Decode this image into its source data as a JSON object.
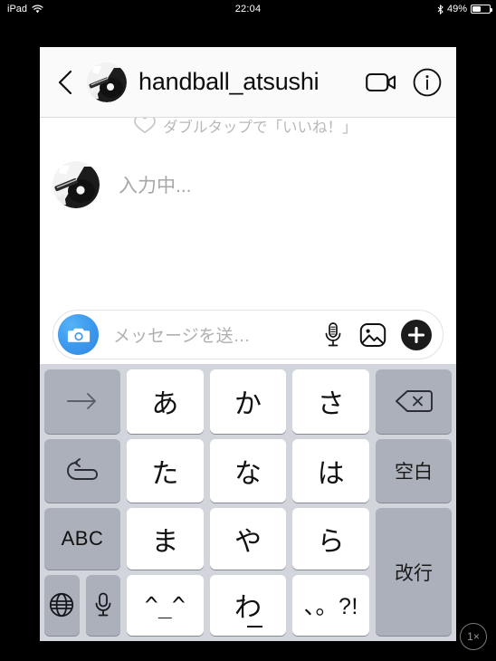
{
  "status_bar": {
    "device_label": "iPad",
    "wifi_icon": "wifi-icon",
    "time": "22:04",
    "bluetooth_icon": "bluetooth-icon",
    "battery_percent": "49%",
    "battery_level": 49
  },
  "nav": {
    "back_icon": "back-chevron-icon",
    "avatar_icon": "user-avatar-guitar-image",
    "title": "handball_atsushi",
    "video_call_icon": "video-camera-icon",
    "info_icon": "info-circle-icon"
  },
  "conversation": {
    "hint_icon": "heart-outline-icon",
    "hint_text": "ダブルタップで「いいね！」",
    "typing_avatar": "user-avatar-guitar-image",
    "typing_text": "入力中..."
  },
  "composer": {
    "camera_icon": "camera-icon",
    "placeholder": "メッセージを送…",
    "mic_icon": "microphone-icon",
    "photo_icon": "photo-gallery-icon",
    "add_icon": "plus-circle-icon"
  },
  "keyboard": {
    "rows": [
      [
        {
          "label": "→",
          "name": "key-arrow-right",
          "style": "grey",
          "kind": "side"
        },
        {
          "label": "あ",
          "name": "key-a",
          "style": "white",
          "kind": "char"
        },
        {
          "label": "か",
          "name": "key-ka",
          "style": "white",
          "kind": "char"
        },
        {
          "label": "さ",
          "name": "key-sa",
          "style": "white",
          "kind": "char"
        },
        {
          "label": "⌫",
          "name": "key-delete",
          "style": "grey",
          "kind": "side"
        }
      ],
      [
        {
          "label": "↺",
          "name": "key-undo",
          "style": "grey",
          "kind": "side"
        },
        {
          "label": "た",
          "name": "key-ta",
          "style": "white",
          "kind": "char"
        },
        {
          "label": "な",
          "name": "key-na",
          "style": "white",
          "kind": "char"
        },
        {
          "label": "は",
          "name": "key-ha",
          "style": "white",
          "kind": "char"
        },
        {
          "label": "空白",
          "name": "key-space",
          "style": "grey",
          "kind": "side"
        }
      ],
      [
        {
          "label": "ABC",
          "name": "key-abc",
          "style": "grey",
          "kind": "side"
        },
        {
          "label": "ま",
          "name": "key-ma",
          "style": "white",
          "kind": "char"
        },
        {
          "label": "や",
          "name": "key-ya",
          "style": "white",
          "kind": "char"
        },
        {
          "label": "ら",
          "name": "key-ra",
          "style": "white",
          "kind": "char"
        },
        {
          "label": "改行",
          "name": "key-return",
          "style": "grey",
          "kind": "side-tall"
        }
      ],
      [
        {
          "label": "🌐",
          "name": "key-globe",
          "style": "grey",
          "kind": "side-narrow"
        },
        {
          "label": "🎤",
          "name": "key-dictation",
          "style": "grey",
          "kind": "side-narrow"
        },
        {
          "label": "^_^",
          "name": "key-emoji-face",
          "style": "white",
          "kind": "char"
        },
        {
          "label": "わ",
          "name": "key-wa",
          "style": "white",
          "kind": "char"
        },
        {
          "label": "、。?!",
          "name": "key-punctuation",
          "style": "white",
          "kind": "char"
        }
      ]
    ],
    "labels": {
      "arrow_right": "→",
      "undo": "↺",
      "space": "空白",
      "abc": "ABC",
      "return": "改行",
      "emoji_face": "^_^",
      "wa": "わ",
      "punctuation": "、。?!",
      "a": "あ",
      "ka": "か",
      "sa": "さ",
      "ta": "た",
      "na": "な",
      "ha": "は",
      "ma": "ま",
      "ya": "や",
      "ra": "ら"
    }
  },
  "zoom_badge": {
    "label": "1×"
  },
  "colors": {
    "accent_blue": "#3f9cf0",
    "keyboard_bg": "#d2d5dc",
    "key_grey": "#abb0ba",
    "key_white": "#ffffff",
    "nav_bg": "#fafafa",
    "hint_grey": "#b8b8b8"
  }
}
